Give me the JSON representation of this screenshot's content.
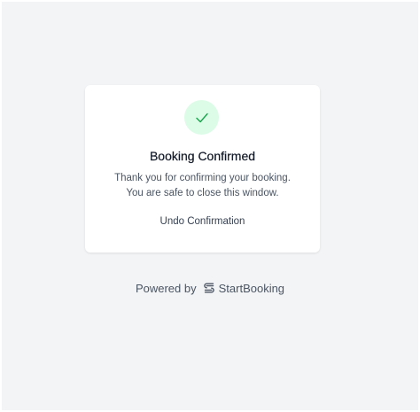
{
  "card": {
    "status_icon": "check-icon",
    "title": "Booking Confirmed",
    "message_line1": "Thank you for confirming your booking.",
    "message_line2": "You are safe to close this window.",
    "undo_label": "Undo Confirmation"
  },
  "footer": {
    "powered_by": "Powered by",
    "brand_icon": "startbooking-logo-icon",
    "brand_name": "StartBooking"
  },
  "colors": {
    "background": "#f3f4f6",
    "card": "#ffffff",
    "success_bg": "#dcfce7",
    "success_check": "#16a34a",
    "text_primary": "#111827",
    "text_secondary": "#4b5563"
  }
}
